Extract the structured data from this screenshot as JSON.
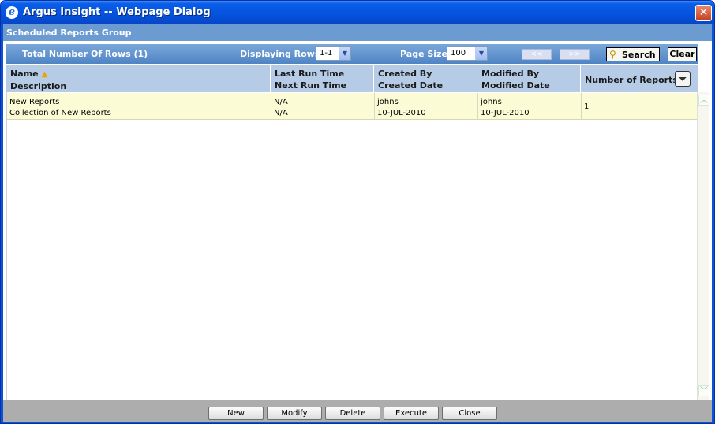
{
  "window": {
    "title": "Argus Insight -- Webpage Dialog",
    "icon": "ie-icon",
    "close_glyph": "✕"
  },
  "group_title": "Scheduled Reports Group",
  "toolbar": {
    "total_rows_label": "Total Number Of Rows (1)",
    "displaying_rows_label": "Displaying Rows",
    "displaying_rows_value": "1-1",
    "page_size_label": "Page Size",
    "page_size_value": "100",
    "prev_label": "<<",
    "next_label": ">>",
    "search_label": "Search",
    "clear_label": "Clear"
  },
  "columns": [
    {
      "line1": "Name",
      "line2": "Description",
      "sort": "ascending"
    },
    {
      "line1": "Last Run Time",
      "line2": "Next Run Time"
    },
    {
      "line1": "Created By",
      "line2": "Created Date"
    },
    {
      "line1": "Modified By",
      "line2": "Modified Date"
    },
    {
      "line1": "Number of Reports",
      "line2": ""
    }
  ],
  "rows": [
    {
      "name": "New Reports",
      "description": "Collection of New Reports",
      "last_run_time": "N/A",
      "next_run_time": "N/A",
      "created_by": "johns",
      "created_date": "10-JUL-2010",
      "modified_by": "johns",
      "modified_date": "10-JUL-2010",
      "number_of_reports": "1"
    }
  ],
  "footer_buttons": {
    "new": "New",
    "modify": "Modify",
    "delete": "Delete",
    "execute": "Execute",
    "close": "Close"
  },
  "colors": {
    "titlebar": "#0553e0",
    "group_bar": "#6b9bd1",
    "header_row": "#b5cbe6",
    "selected_row": "#fbfbd6",
    "footer": "#adadad"
  }
}
